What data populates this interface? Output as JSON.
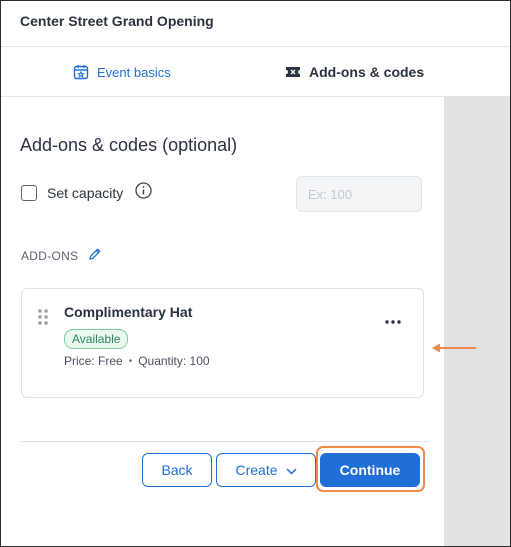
{
  "header": {
    "title": "Center Street Grand Opening"
  },
  "tabs": [
    {
      "label": "Event basics",
      "icon": "calendar-star-icon",
      "active": false
    },
    {
      "label": "Add-ons & codes",
      "icon": "ticket-icon",
      "active": true
    }
  ],
  "section": {
    "title": "Add-ons & codes (optional)",
    "capacity": {
      "label": "Set capacity",
      "checked": false,
      "placeholder": "Ex: 100",
      "value": ""
    },
    "addons_label": "ADD-ONS"
  },
  "addon": {
    "name": "Complimentary Hat",
    "status": "Available",
    "price": "Price: Free",
    "separator": "•",
    "quantity": "Quantity: 100"
  },
  "footer": {
    "back": "Back",
    "create": "Create",
    "continue": "Continue"
  },
  "colors": {
    "accent": "#1f6fd6",
    "highlight": "#f08a4b",
    "available_green": "#2e8b57",
    "side_panel": "#e2e2e2"
  }
}
